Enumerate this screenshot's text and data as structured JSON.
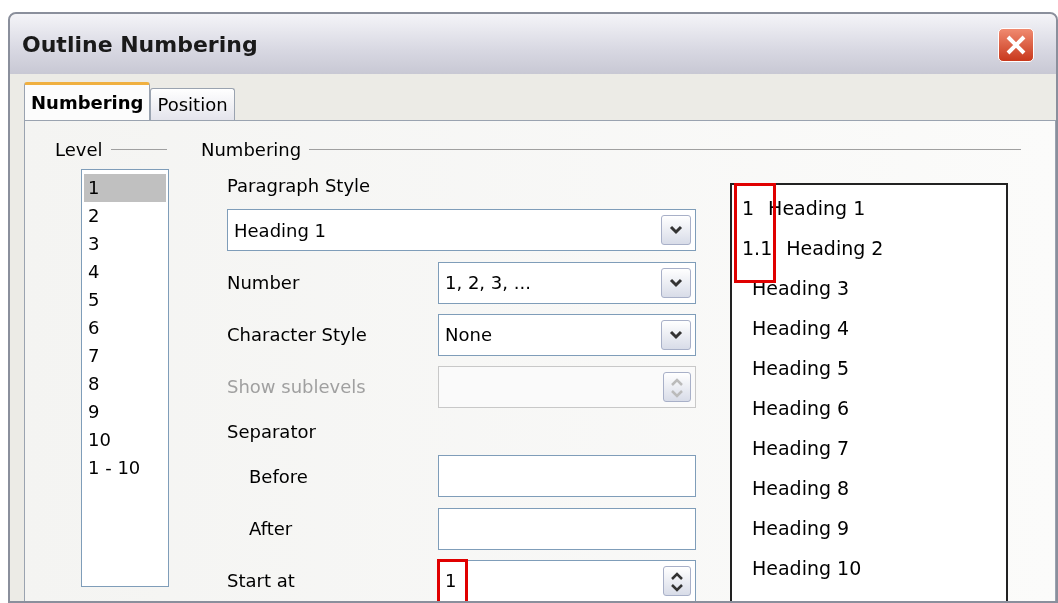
{
  "window": {
    "title": "Outline Numbering"
  },
  "tabs": [
    {
      "label": "Numbering",
      "selected": true
    },
    {
      "label": "Position",
      "selected": false
    }
  ],
  "level": {
    "label": "Level",
    "items": [
      {
        "label": "1",
        "selected": true
      },
      {
        "label": "2",
        "selected": false
      },
      {
        "label": "3",
        "selected": false
      },
      {
        "label": "4",
        "selected": false
      },
      {
        "label": "5",
        "selected": false
      },
      {
        "label": "6",
        "selected": false
      },
      {
        "label": "7",
        "selected": false
      },
      {
        "label": "8",
        "selected": false
      },
      {
        "label": "9",
        "selected": false
      },
      {
        "label": "10",
        "selected": false
      },
      {
        "label": "1 - 10",
        "selected": false
      }
    ]
  },
  "numbering": {
    "label": "Numbering",
    "fields": [
      {
        "kind": "wide-combo",
        "label": "Paragraph Style",
        "value": "Heading 1",
        "disabled": false
      },
      {
        "kind": "combo",
        "label": "Number",
        "value": "1, 2, 3, ...",
        "disabled": false
      },
      {
        "kind": "combo",
        "label": "Character Style",
        "value": "None",
        "disabled": false
      },
      {
        "kind": "spin",
        "label": "Show sublevels",
        "disabled": true,
        "highlighted": false
      },
      {
        "kind": "heading",
        "label": "Separator"
      },
      {
        "kind": "subtext",
        "label": "Before",
        "disabled": false
      },
      {
        "kind": "subtext",
        "label": "After",
        "disabled": false
      },
      {
        "kind": "spin",
        "label": "Start at",
        "value": "1",
        "disabled": false,
        "highlighted": true
      }
    ]
  },
  "preview": {
    "highlight_numbers": true,
    "items": [
      {
        "number": "1",
        "text": "Heading 1"
      },
      {
        "number": "1.1",
        "text": "Heading 2"
      },
      {
        "text": "Heading 3"
      },
      {
        "text": "Heading 4"
      },
      {
        "text": "Heading 5"
      },
      {
        "text": "Heading 6"
      },
      {
        "text": "Heading 7"
      },
      {
        "text": "Heading 8"
      },
      {
        "text": "Heading 9"
      },
      {
        "text": "Heading 10"
      }
    ]
  }
}
